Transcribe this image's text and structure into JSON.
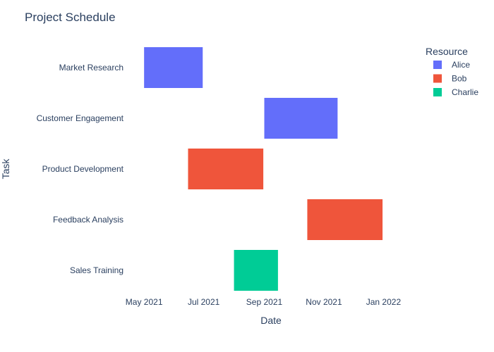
{
  "chart_data": {
    "type": "gantt",
    "title": "Project Schedule",
    "xlabel": "Date",
    "ylabel": "Task",
    "x_axis": {
      "type": "date",
      "range": [
        "2021-04-15",
        "2022-01-31"
      ],
      "ticks": [
        {
          "date": "2021-05-01",
          "label": "May 2021"
        },
        {
          "date": "2021-07-01",
          "label": "Jul 2021"
        },
        {
          "date": "2021-09-01",
          "label": "Sep 2021"
        },
        {
          "date": "2021-11-01",
          "label": "Nov 2021"
        },
        {
          "date": "2022-01-01",
          "label": "Jan 2022"
        }
      ]
    },
    "tasks": [
      "Market Research",
      "Customer Engagement",
      "Product Development",
      "Feedback Analysis",
      "Sales Training"
    ],
    "bars": [
      {
        "task": "Market Research",
        "resource": "Alice",
        "start": "2021-05-01",
        "end": "2021-06-30"
      },
      {
        "task": "Customer Engagement",
        "resource": "Alice",
        "start": "2021-09-01",
        "end": "2021-11-15"
      },
      {
        "task": "Product Development",
        "resource": "Bob",
        "start": "2021-06-15",
        "end": "2021-08-31"
      },
      {
        "task": "Feedback Analysis",
        "resource": "Bob",
        "start": "2021-10-15",
        "end": "2021-12-31"
      },
      {
        "task": "Sales Training",
        "resource": "Charlie",
        "start": "2021-08-01",
        "end": "2021-09-15"
      }
    ],
    "legend": {
      "title": "Resource",
      "placement": "top-right",
      "items": [
        {
          "name": "Alice",
          "color": "#636efa"
        },
        {
          "name": "Bob",
          "color": "#ef553b"
        },
        {
          "name": "Charlie",
          "color": "#00cc96"
        }
      ]
    },
    "grid": false
  }
}
